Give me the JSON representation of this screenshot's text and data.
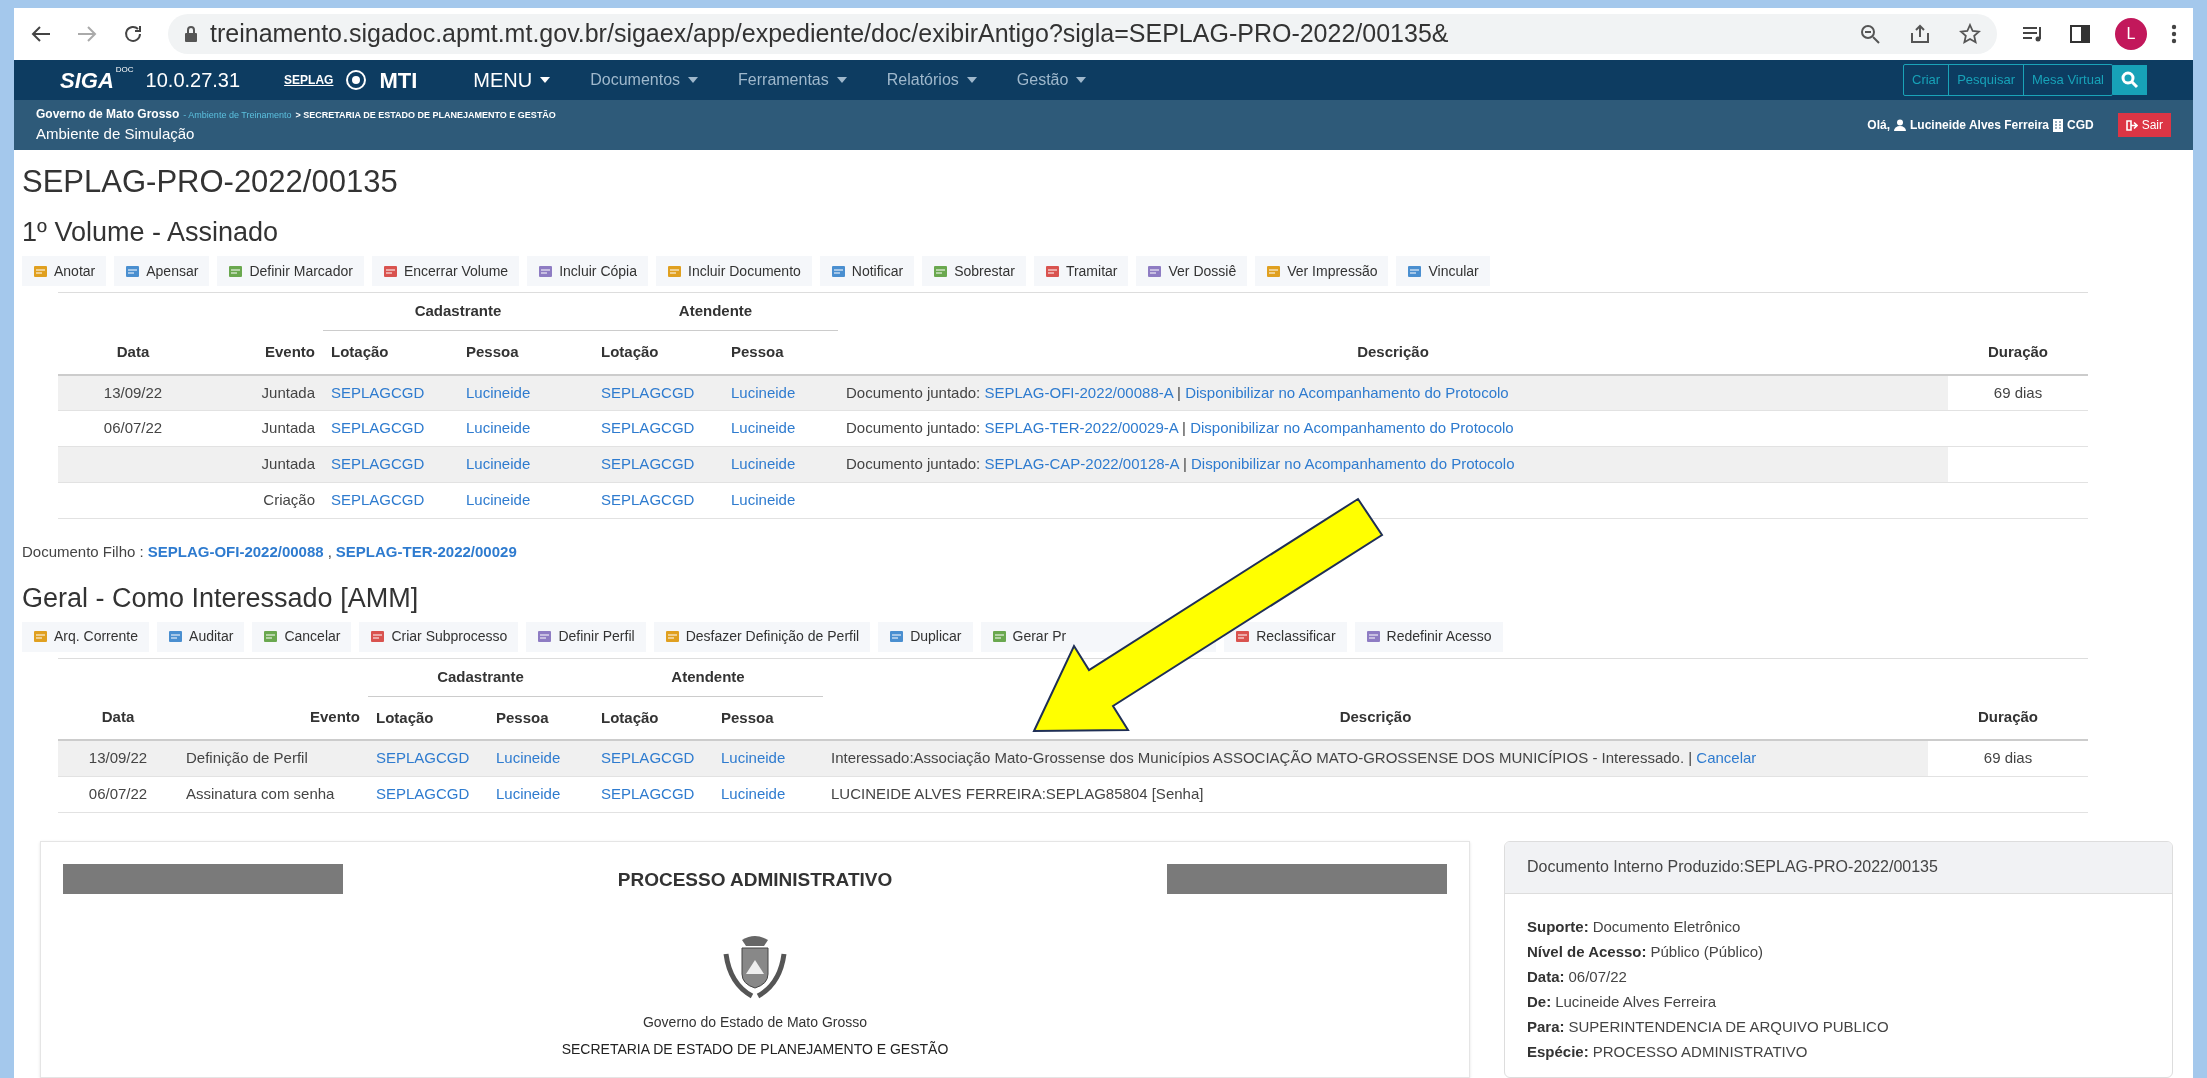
{
  "browser": {
    "url": "treinamento.sigadoc.apmt.mt.gov.br/sigaex/app/expediente/doc/exibirAntigo?sigla=SEPLAG-PRO-2022/00135&",
    "profile_initial": "L"
  },
  "app_header": {
    "logo": "SIGA",
    "logo_sup": "DOC",
    "version": "10.0.27.31",
    "brand": "SEPLAG",
    "brand2": "MTI",
    "menu": [
      {
        "label": "MENU",
        "kind": "primary"
      },
      {
        "label": "Documentos",
        "kind": "dropdown"
      },
      {
        "label": "Ferramentas",
        "kind": "dropdown"
      },
      {
        "label": "Relatórios",
        "kind": "dropdown"
      },
      {
        "label": "Gestão",
        "kind": "dropdown"
      }
    ],
    "actions": [
      "Criar",
      "Pesquisar",
      "Mesa Virtual"
    ]
  },
  "sub_header": {
    "org": "Governo de Mato Grosso",
    "env": "- Ambiente de Treinamento",
    "dept": "> SECRETARIA DE ESTADO DE PLANEJAMENTO E GESTÃO",
    "subtitle": "Ambiente de Simulação",
    "greeting": "Olá,",
    "user": "Lucineide Alves Ferreira",
    "unit": "CGD",
    "logout": "Sair"
  },
  "title": "SEPLAG-PRO-2022/00135",
  "sections": [
    {
      "heading": "1º Volume - Assinado",
      "toolbar": [
        "Anotar",
        "Apensar",
        "Definir Marcador",
        "Encerrar Volume",
        "Incluir Cópia",
        "Incluir Documento",
        "Notificar",
        "Sobrestar",
        "Tramitar",
        "Ver Dossiê",
        "Ver Impressão",
        "Vincular"
      ],
      "group_headers": [
        "Cadastrante",
        "Atendente"
      ],
      "columns": [
        "Data",
        "Evento",
        "Lotação",
        "Pessoa",
        "Lotação",
        "Pessoa",
        "Descrição",
        "Duração"
      ],
      "rows": [
        {
          "date": "13/09/22",
          "event": "Juntada",
          "cad_lotacao": "SEPLAGCGD",
          "cad_pessoa": "Lucineide",
          "at_lotacao": "SEPLAGCGD",
          "at_pessoa": "Lucineide",
          "description": [
            {
              "kind": "text",
              "text": "Documento juntado:"
            },
            {
              "kind": "link",
              "text": "SEPLAG-OFI-2022/00088-A"
            },
            {
              "kind": "text",
              "text": "|"
            },
            {
              "kind": "link",
              "text": "Disponibilizar no Acompanhamento do Protocolo"
            }
          ],
          "duration": "69 dias"
        },
        {
          "date": "06/07/22",
          "event": "Juntada",
          "cad_lotacao": "SEPLAGCGD",
          "cad_pessoa": "Lucineide",
          "at_lotacao": "SEPLAGCGD",
          "at_pessoa": "Lucineide",
          "description": [
            {
              "kind": "text",
              "text": "Documento juntado:"
            },
            {
              "kind": "link",
              "text": "SEPLAG-TER-2022/00029-A"
            },
            {
              "kind": "text",
              "text": "|"
            },
            {
              "kind": "link",
              "text": "Disponibilizar no Acompanhamento do Protocolo"
            }
          ]
        },
        {
          "event": "Juntada",
          "cad_lotacao": "SEPLAGCGD",
          "cad_pessoa": "Lucineide",
          "at_lotacao": "SEPLAGCGD",
          "at_pessoa": "Lucineide",
          "description": [
            {
              "kind": "text",
              "text": "Documento juntado:"
            },
            {
              "kind": "link",
              "text": "SEPLAG-CAP-2022/00128-A"
            },
            {
              "kind": "text",
              "text": "|"
            },
            {
              "kind": "link",
              "text": "Disponibilizar no Acompanhamento do Protocolo"
            }
          ]
        },
        {
          "event": "Criação",
          "cad_lotacao": "SEPLAGCGD",
          "cad_pessoa": "Lucineide",
          "at_lotacao": "SEPLAGCGD",
          "at_pessoa": "Lucineide"
        }
      ],
      "children": {
        "label": "Documento Filho :",
        "links": [
          "SEPLAG-OFI-2022/00088",
          "SEPLAG-TER-2022/00029"
        ],
        "separator": ","
      }
    },
    {
      "heading": "Geral - Como Interessado [AMM]",
      "toolbar": [
        "Arq. Corrente",
        "Auditar",
        "Cancelar",
        "Criar Subprocesso",
        "Definir Perfil",
        "Desfazer Definição de Perfil",
        "Duplicar",
        "Gerar Pr",
        "Reclassificar",
        "Redefinir Acesso"
      ],
      "group_headers": [
        "Cadastrante",
        "Atendente"
      ],
      "columns": [
        "Data",
        "Evento",
        "Lotação",
        "Pessoa",
        "Lotação",
        "Pessoa",
        "Descrição",
        "Duração"
      ],
      "rows": [
        {
          "date": "13/09/22",
          "event": "Definição de Perfil",
          "cad_lotacao": "SEPLAGCGD",
          "cad_pessoa": "Lucineide",
          "at_lotacao": "SEPLAGCGD",
          "at_pessoa": "Lucineide",
          "description": [
            {
              "kind": "text",
              "text": "Interessado:Associação Mato-Grossense dos Municípios ASSOCIAÇÃO MATO-GROSSENSE DOS MUNICÍPIOS - Interessado. |"
            },
            {
              "kind": "link",
              "text": "Cancelar"
            }
          ],
          "duration": "69 dias"
        },
        {
          "date": "06/07/22",
          "event": "Assinatura com senha",
          "cad_lotacao": "SEPLAGCGD",
          "cad_pessoa": "Lucineide",
          "at_lotacao": "SEPLAGCGD",
          "at_pessoa": "Lucineide",
          "description": [
            {
              "kind": "text",
              "text": "LUCINEIDE ALVES FERREIRA:SEPLAG85804 [Senha]"
            }
          ]
        }
      ]
    }
  ],
  "document": {
    "title": "PROCESSO ADMINISTRATIVO",
    "government": "Governo do Estado de Mato Grosso",
    "secretariat": "SECRETARIA DE ESTADO DE PLANEJAMENTO E GESTÃO"
  },
  "info_card": {
    "header": "Documento Interno Produzido:SEPLAG-PRO-2022/00135",
    "fields": [
      {
        "label": "Suporte:",
        "value": "Documento Eletrônico"
      },
      {
        "label": "Nível de Acesso:",
        "value": "Público (Público)"
      },
      {
        "label": "Data:",
        "value": "06/07/22"
      },
      {
        "label": "De:",
        "value": "Lucineide Alves Ferreira"
      },
      {
        "label": "Para:",
        "value": "SUPERINTENDENCIA DE ARQUIVO PUBLICO"
      },
      {
        "label": "Espécie:",
        "value": "PROCESSO ADMINISTRATIVO"
      }
    ]
  }
}
